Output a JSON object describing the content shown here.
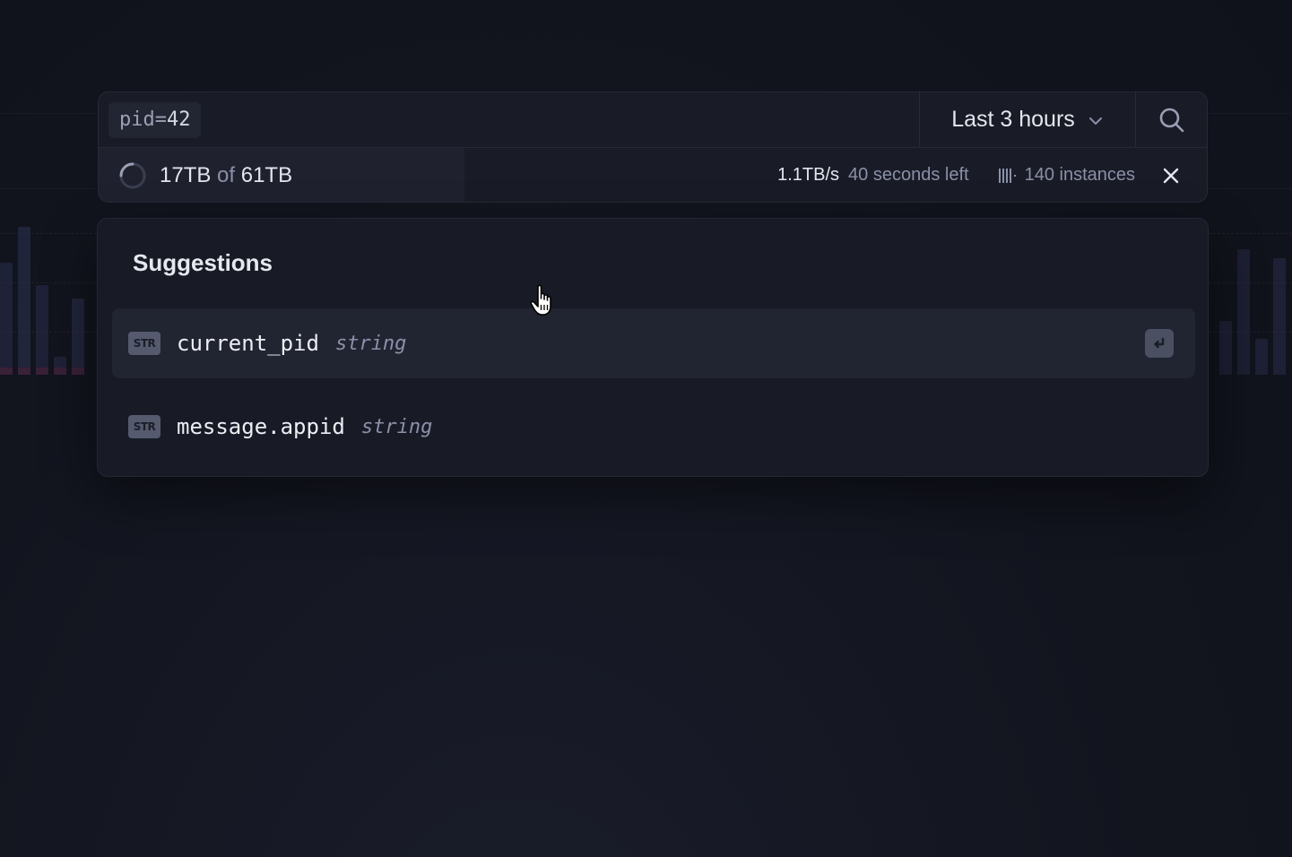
{
  "search": {
    "query_key": "pid=",
    "query_value": "42",
    "time_range": "Last 3 hours",
    "search_icon": "search-icon"
  },
  "progress": {
    "scanned": "17TB",
    "of_label": "of",
    "total": "61TB",
    "fraction": 0.33,
    "speed": "1.1TB/s",
    "eta": "40 seconds left",
    "instances": "140 instances"
  },
  "suggestions": {
    "title": "Suggestions",
    "items": [
      {
        "badge": "STR",
        "name": "current_pid",
        "type": "string",
        "active": true
      },
      {
        "badge": "STR",
        "name": "message.appid",
        "type": "string",
        "active": false
      }
    ]
  },
  "colors": {
    "background": "#12141e",
    "panel": "#181a25",
    "active_row": "#212431",
    "text_primary": "#e4e6ee",
    "text_muted": "#8a90a8"
  }
}
